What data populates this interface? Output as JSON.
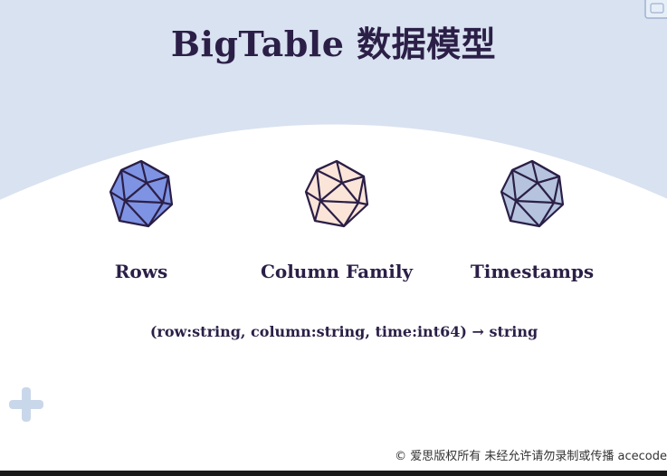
{
  "slide": {
    "title": "BigTable 数据模型",
    "concepts": [
      {
        "label": "Rows",
        "icon": "icosahedron-icon",
        "fill": "#7e93e4"
      },
      {
        "label": "Column Family",
        "icon": "icosahedron-icon",
        "fill": "#fbe5d8"
      },
      {
        "label": "Timestamps",
        "icon": "icosahedron-icon",
        "fill": "#b5c3de"
      }
    ],
    "signature": "(row:string, column:string, time:int64) → string",
    "footer": "© 爱思版权所有 未经允许请勿录制或传播 acecode"
  },
  "colors": {
    "background_top": "#d9e2f0",
    "background_main": "#ffffff",
    "text": "#2b1f47",
    "outline": "#2b1f47"
  }
}
